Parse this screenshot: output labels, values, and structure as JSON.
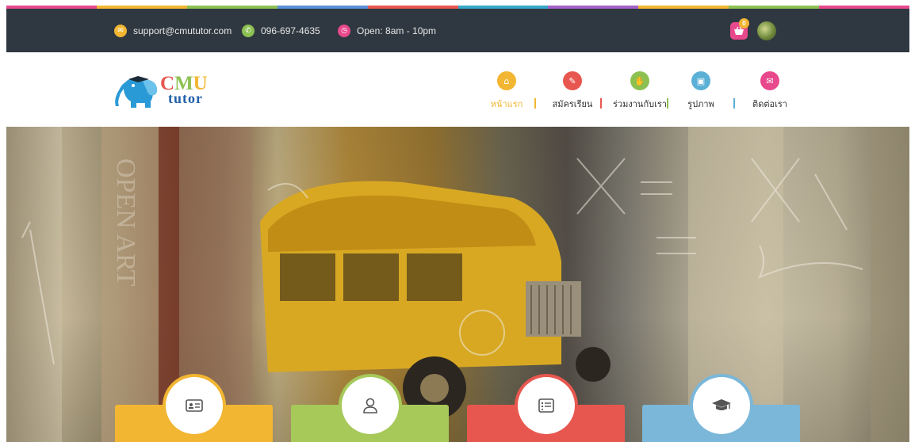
{
  "colors": {
    "topbar_bg": "#2f3840",
    "rainbow": [
      "#e8498c",
      "#f2b632",
      "#8cc152",
      "#5b8fd6",
      "#e8574f",
      "#35a8c9",
      "#a262c9",
      "#f2b632",
      "#8cc152",
      "#e8498c"
    ],
    "email_icon": "#f2b632",
    "phone_icon": "#8cc152",
    "clock_icon": "#e8498c",
    "cart": "#e8498c",
    "nav_active": "#f2b632"
  },
  "topbar": {
    "email": "support@cmututor.com",
    "phone": "096-697-4635",
    "hours": "Open: 8am - 10pm",
    "cart_count": "0",
    "icons": {
      "email": "envelope-icon",
      "phone": "phone-icon",
      "hours": "clock-icon",
      "cart": "basket-icon"
    }
  },
  "logo": {
    "cmu": "CMU",
    "tutor": "tutor",
    "mascot": "elephant-icon"
  },
  "nav": {
    "items": [
      {
        "label": "หน้าแรก",
        "icon": "home-icon",
        "color": "#f2b632",
        "active": true
      },
      {
        "label": "สมัครเรียน",
        "icon": "pencil-icon",
        "color": "#e8574f",
        "active": false
      },
      {
        "label": "ร่วมงานกับเรา",
        "icon": "handshake-icon",
        "color": "#8cc152",
        "active": false
      },
      {
        "label": "รูปภาพ",
        "icon": "image-icon",
        "color": "#5bb0d6",
        "active": false
      },
      {
        "label": "ติดต่อเรา",
        "icon": "envelope-icon",
        "color": "#e8498c",
        "active": false
      }
    ],
    "separator_colors": [
      "#f2b632",
      "#e8574f",
      "#8cc152",
      "#5bb0d6"
    ]
  },
  "hero": {
    "image": "school-bus-photo"
  },
  "feature_cards": [
    {
      "icon": "id-card-icon",
      "color": "#f2b632"
    },
    {
      "icon": "user-icon",
      "color": "#a6c95a"
    },
    {
      "icon": "list-icon",
      "color": "#e8574f"
    },
    {
      "icon": "graduation-cap-icon",
      "color": "#7ab7d9"
    }
  ]
}
